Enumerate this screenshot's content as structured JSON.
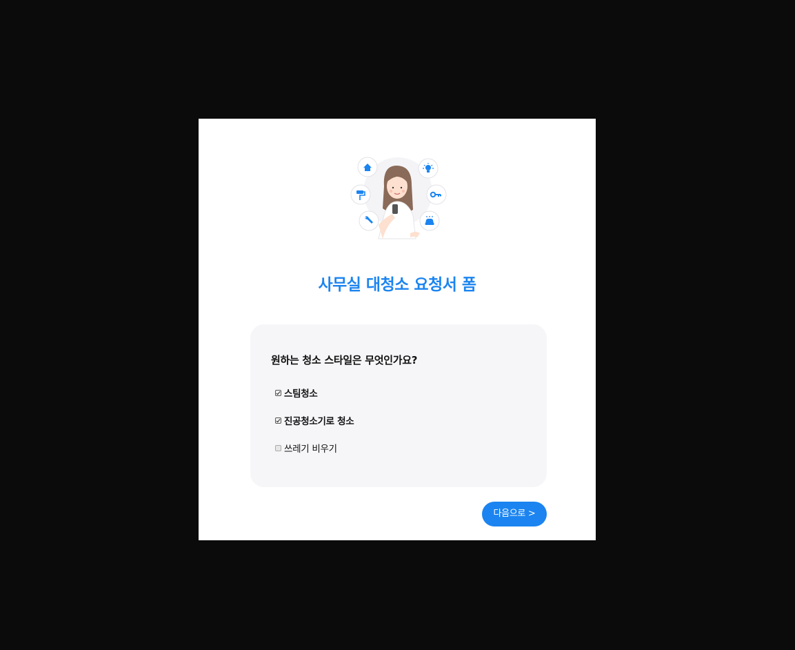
{
  "form": {
    "title": "사무실 대청소 요청서 폼",
    "question": "원하는 청소 스타일은 무엇인가요?",
    "options": [
      {
        "label": "스팀청소",
        "checked": true
      },
      {
        "label": "진공청소기로 청소",
        "checked": true
      },
      {
        "label": "쓰레기 비우기",
        "checked": false
      }
    ],
    "next_label": "다음으로 >"
  },
  "hero": {
    "icons": [
      "home-icon",
      "lightbulb-icon",
      "paint-roller-icon",
      "key-icon",
      "wrench-icon",
      "car-wash-icon"
    ]
  },
  "colors": {
    "accent": "#1b84f0",
    "panel_bg": "#f6f6f9",
    "backdrop": "#0b0b0b"
  }
}
